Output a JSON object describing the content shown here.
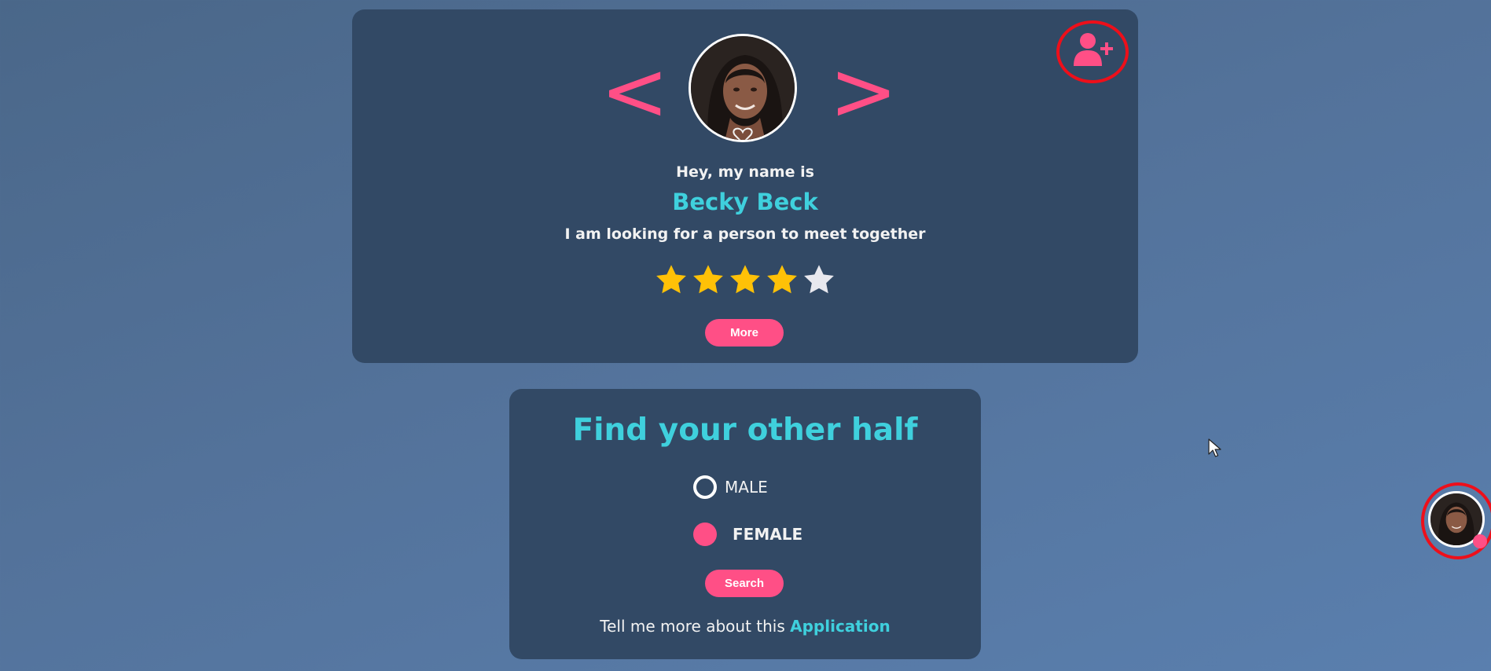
{
  "profile": {
    "nav": {
      "prev_icon": "<",
      "next_icon": ">"
    },
    "avatar_icon": "profile-photo",
    "add_friend_icon": "user-plus-icon",
    "intro": "Hey, my name is",
    "name": "Becky Beck",
    "bio": "I am looking for a person to meet together",
    "rating": {
      "value": 4,
      "max": 5
    },
    "more_label": "More"
  },
  "search": {
    "title": "Find your other half",
    "options": [
      {
        "label": "MALE",
        "selected": false
      },
      {
        "label": "FEMALE",
        "selected": true
      }
    ],
    "search_label": "Search",
    "about_text": "Tell me more about this",
    "about_link": "Application"
  },
  "colors": {
    "accent": "#ff4f86",
    "title": "#3fd0dd",
    "card": "#324965",
    "star_filled": "#ffc107",
    "star_empty": "#e8e8ee",
    "highlight_ring": "#ee0f1a"
  }
}
